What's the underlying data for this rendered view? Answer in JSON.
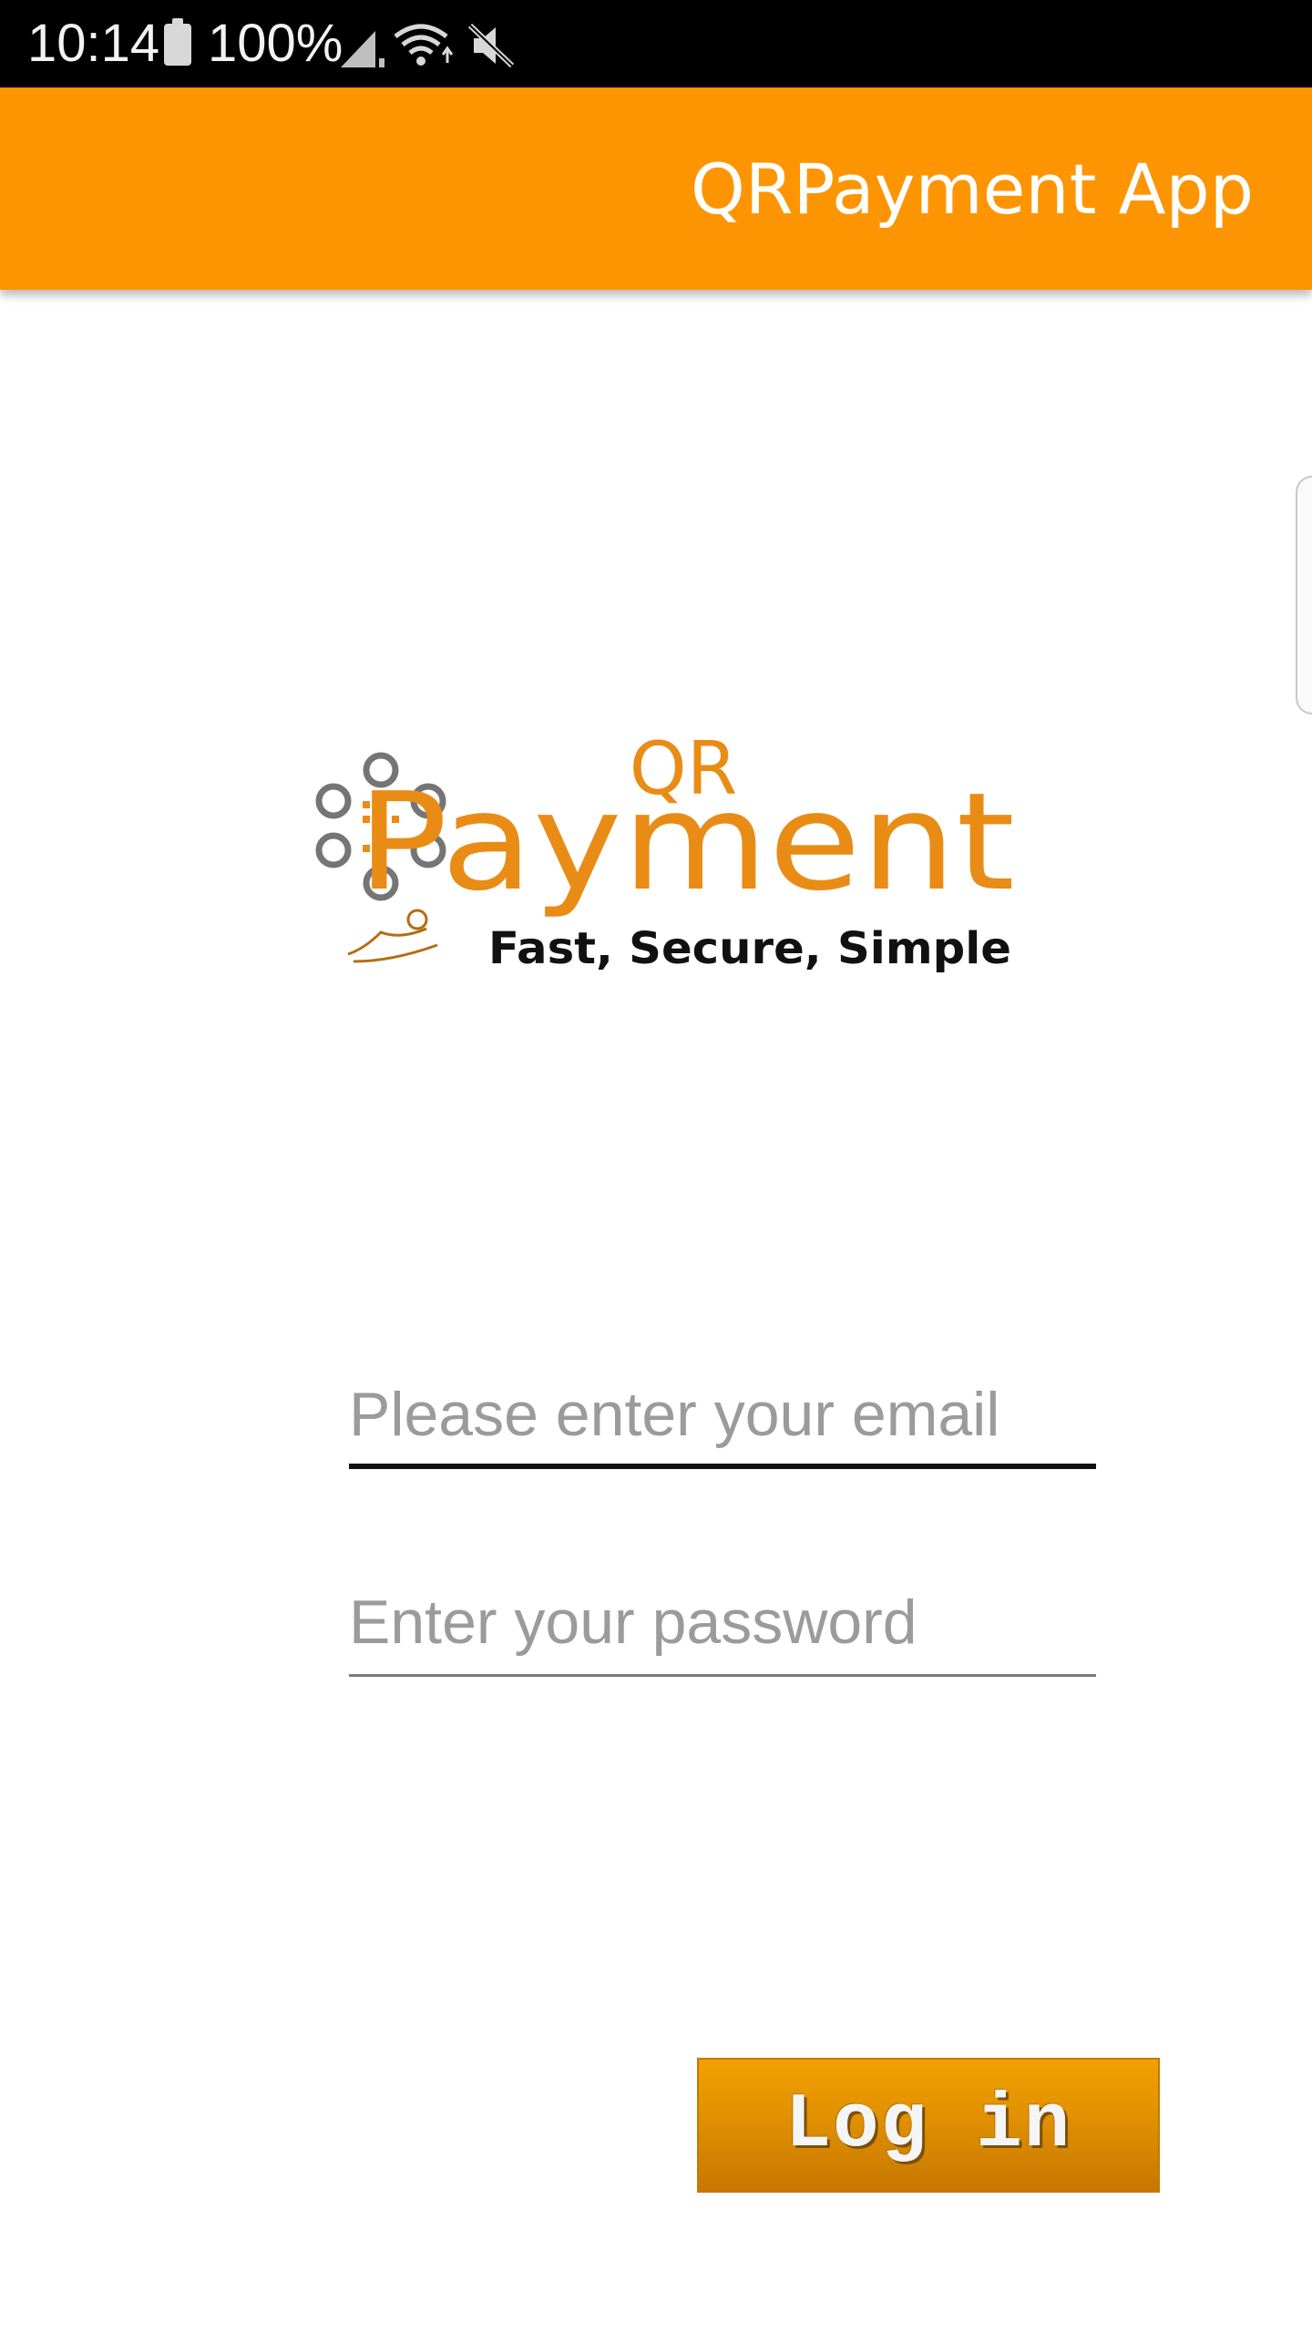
{
  "status_bar": {
    "time": "10:14",
    "battery": "100%"
  },
  "app_bar": {
    "title": "QRPayment App"
  },
  "logo": {
    "top_text": "QR",
    "main_text": "Payment",
    "tagline": "Fast, Secure, Simple"
  },
  "form": {
    "email_placeholder": "Please enter your email",
    "password_placeholder": "Enter your password"
  },
  "login_button": {
    "label": "Log in"
  },
  "colors": {
    "app_bar": "#fd9503",
    "button": "#e09000",
    "logo_orange": "#e98c16",
    "logo_gray": "#757575"
  }
}
